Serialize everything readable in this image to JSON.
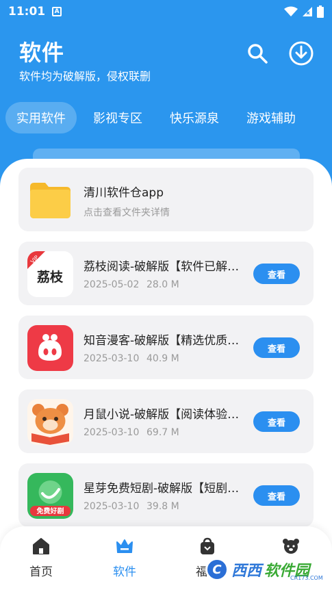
{
  "status_bar": {
    "time": "11:01",
    "app_icon_letter": "A",
    "icons": [
      "wifi-icon",
      "signal-icon",
      "battery-icon"
    ]
  },
  "header": {
    "title": "软件",
    "subtitle": "软件均为破解版，侵权联删",
    "actions": [
      "search-icon",
      "download-icon"
    ]
  },
  "tabs": [
    {
      "label": "实用软件",
      "active": true
    },
    {
      "label": "影视专区",
      "active": false
    },
    {
      "label": "快乐源泉",
      "active": false
    },
    {
      "label": "游戏辅助",
      "active": false
    }
  ],
  "folder": {
    "title": "清川软件仓app",
    "description": "点击查看文件夹详情"
  },
  "apps": [
    {
      "title": "荔枝阅读-破解版【软件已解锁】",
      "date": "2025-05-02",
      "size": "28.0 M",
      "button": "查看",
      "icon": "lychee-reader-icon",
      "icon_text": "荔枝",
      "badge": "VIP"
    },
    {
      "title": "知音漫客-破解版【精选优质漫画】",
      "date": "2025-03-10",
      "size": "40.9 M",
      "button": "查看",
      "icon": "zhiyin-manke-icon"
    },
    {
      "title": "月鼠小说-破解版【阅读体验极佳】",
      "date": "2025-03-10",
      "size": "69.7 M",
      "button": "查看",
      "icon": "yueshu-novel-icon"
    },
    {
      "title": "星芽免费短剧-破解版【短剧资源】",
      "date": "2025-03-10",
      "size": "39.8 M",
      "button": "查看",
      "icon": "xingya-drama-icon",
      "icon_text": "免费好剧"
    }
  ],
  "bottom_nav": [
    {
      "label": "首页",
      "icon": "home-icon",
      "active": false
    },
    {
      "label": "软件",
      "icon": "crown-icon",
      "active": true
    },
    {
      "label": "福利",
      "icon": "bag-icon",
      "active": false
    },
    {
      "label": "",
      "icon": "bear-icon",
      "active": false
    }
  ],
  "watermark": {
    "logo": "C",
    "text1": "西西",
    "text2": "软件园",
    "domain": "CR173.COM"
  },
  "colors": {
    "primary": "#2b96ee",
    "button": "#2b8ff0",
    "card_bg": "#f2f2f4"
  }
}
